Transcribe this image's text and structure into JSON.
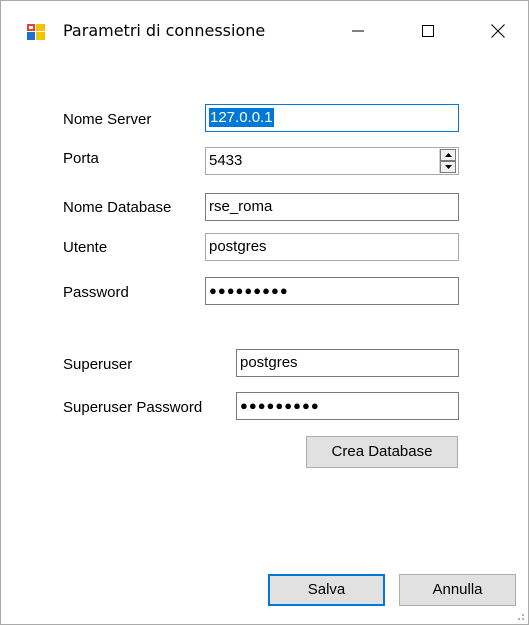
{
  "window": {
    "title": "Parametri di connessione",
    "icon": "app-window-icon",
    "controls": {
      "minimize": "minimize-icon",
      "maximize": "maximize-icon",
      "close": "close-icon"
    }
  },
  "form": {
    "server_label": "Nome Server",
    "server_value": "127.0.0.1",
    "port_label": "Porta",
    "port_value": "5433",
    "database_label": "Nome Database",
    "database_value": "rse_roma",
    "user_label": "Utente",
    "user_value": "postgres",
    "password_label": "Password",
    "password_value": "●●●●●●●●●",
    "superuser_label": "Superuser",
    "superuser_value": "postgres",
    "superuser_password_label": "Superuser Password",
    "superuser_password_value": "●●●●●●●●●"
  },
  "buttons": {
    "create_db": "Crea Database",
    "save": "Salva",
    "cancel": "Annulla"
  },
  "colors": {
    "selection": "#0078d7",
    "button_bg": "#e1e1e1"
  }
}
